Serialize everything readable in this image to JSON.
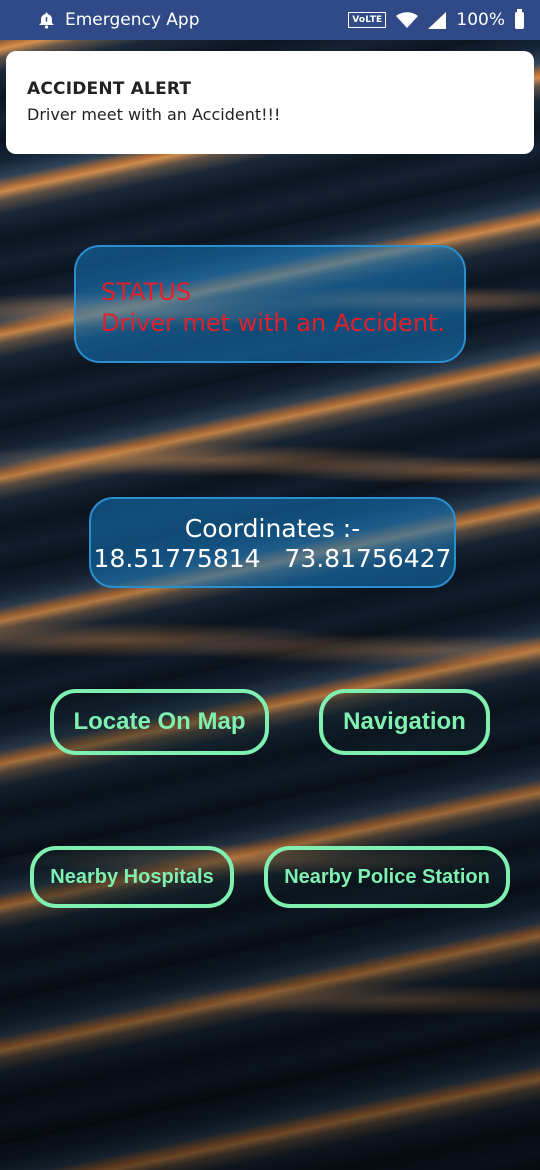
{
  "status_bar": {
    "app_name": "Emergency App",
    "volte": "VoLTE",
    "battery": "100%",
    "icons": [
      "alarm-icon",
      "wifi-icon",
      "signal-icon",
      "battery-icon"
    ]
  },
  "notification": {
    "title": "ACCIDENT ALERT",
    "body": "Driver meet with an Accident!!!"
  },
  "status_card": {
    "label": "STATUS",
    "message": "Driver met with an Accident.",
    "text_color": "#e0202a"
  },
  "coordinates": {
    "label": "Coordinates :-",
    "latitude": "18.51775814",
    "longitude": "73.81756427"
  },
  "buttons": {
    "locate_on_map": "Locate On Map",
    "navigation": "Navigation",
    "nearby_hospitals": "Nearby Hospitals",
    "nearby_police_station": "Nearby Police Station"
  },
  "colors": {
    "status_bar": "#2f4a86",
    "card_border": "#2a8fcf",
    "button_accent": "#7ff0b0"
  }
}
